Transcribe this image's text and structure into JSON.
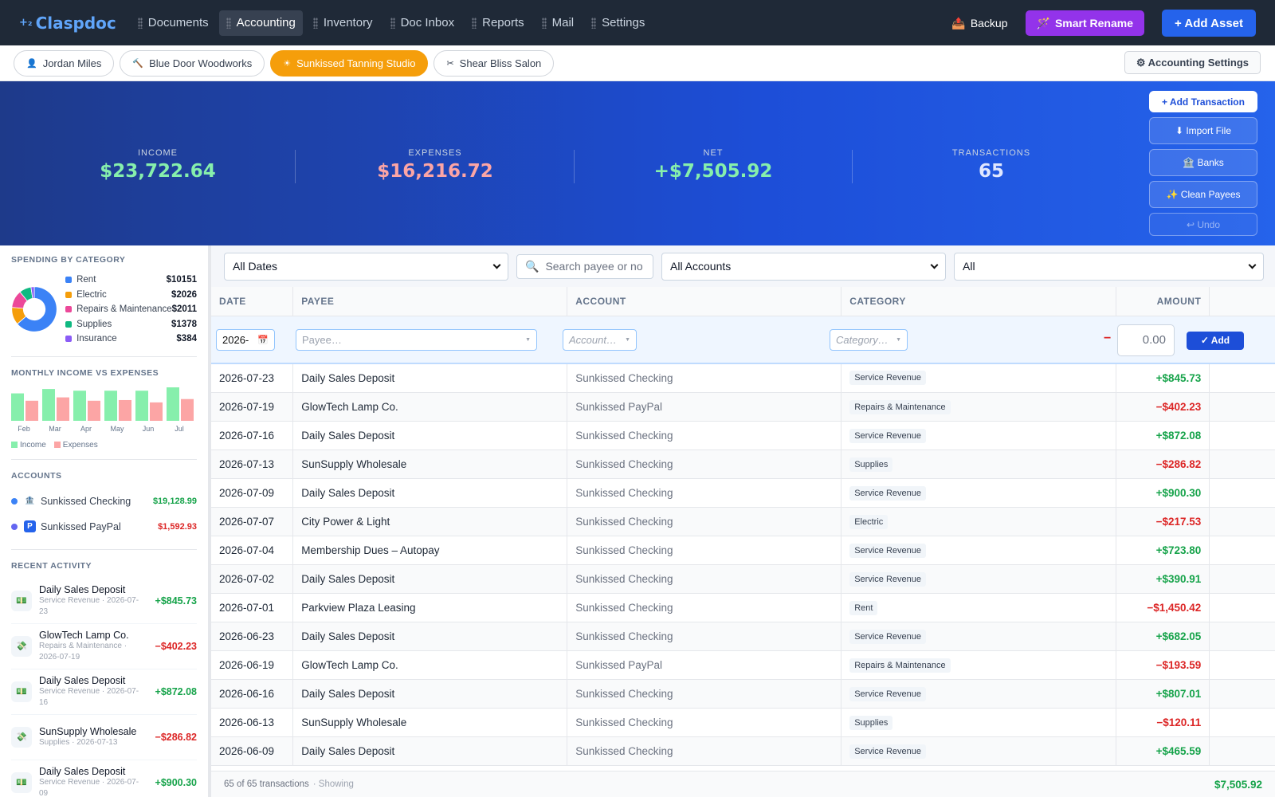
{
  "app": {
    "name": "Claspdoc",
    "logo_mark": "+₂"
  },
  "nav": {
    "items": [
      {
        "label": "Documents",
        "active": false
      },
      {
        "label": "Accounting",
        "active": true
      },
      {
        "label": "Inventory",
        "active": false
      },
      {
        "label": "Doc Inbox",
        "active": false
      },
      {
        "label": "Reports",
        "active": false
      },
      {
        "label": "Mail",
        "active": false
      },
      {
        "label": "Settings",
        "active": false
      }
    ],
    "backup_label": "Backup",
    "smart_rename_label": "Smart Rename",
    "add_asset_label": "+ Add Asset"
  },
  "entities": {
    "items": [
      {
        "label": "Jordan Miles",
        "icon": "user-icon",
        "active": false
      },
      {
        "label": "Blue Door Woodworks",
        "icon": "hammer-icon",
        "active": false
      },
      {
        "label": "Sunkissed Tanning Studio",
        "icon": "sun-icon",
        "active": true
      },
      {
        "label": "Shear Bliss Salon",
        "icon": "scissors-icon",
        "active": false
      }
    ],
    "settings_label": "⚙ Accounting Settings"
  },
  "stats": {
    "income": {
      "label": "INCOME",
      "value": "$23,722.64",
      "color": "#86efac"
    },
    "expenses": {
      "label": "EXPENSES",
      "value": "$16,216.72",
      "color": "#fca5a5"
    },
    "net": {
      "label": "NET",
      "value": "+$7,505.92",
      "color": "#86efac"
    },
    "transactions": {
      "label": "TRANSACTIONS",
      "value": "65",
      "color": "#e0e7ff"
    }
  },
  "banner_actions": {
    "add_transaction": "+ Add Transaction",
    "import_file": "⬇ Import File",
    "banks": "🏦 Banks",
    "clean_payees": "✨ Clean Payees",
    "undo": "↩ Undo"
  },
  "sidebar": {
    "spending_title": "SPENDING BY CATEGORY",
    "spending": [
      {
        "name": "Rent",
        "amount": "$10151",
        "value": 10151,
        "color": "#3b82f6"
      },
      {
        "name": "Electric",
        "amount": "$2026",
        "value": 2026,
        "color": "#f59e0b"
      },
      {
        "name": "Repairs & Maintenance",
        "amount": "$2011",
        "value": 2011,
        "color": "#ec4899"
      },
      {
        "name": "Supplies",
        "amount": "$1378",
        "value": 1378,
        "color": "#10b981"
      },
      {
        "name": "Insurance",
        "amount": "$384",
        "value": 384,
        "color": "#8b5cf6"
      }
    ],
    "monthly_title": "MONTHLY INCOME VS EXPENSES",
    "monthly": {
      "categories": [
        "Feb",
        "Mar",
        "Apr",
        "May",
        "Jun",
        "Jul"
      ],
      "income": [
        0.82,
        0.95,
        0.9,
        0.9,
        0.9,
        1.0
      ],
      "expenses": [
        0.6,
        0.7,
        0.6,
        0.62,
        0.55,
        0.65
      ],
      "income_label": "Income",
      "expenses_label": "Expenses",
      "income_color": "#86efac",
      "expenses_color": "#fca5a5"
    },
    "accounts_title": "ACCOUNTS",
    "accounts": [
      {
        "name": "Sunkissed Checking",
        "balance": "$19,128.99",
        "dot": "#3b82f6",
        "icon": "bank-icon",
        "icon_glyph": "🏦",
        "positive": true
      },
      {
        "name": "Sunkissed PayPal",
        "balance": "$1,592.93",
        "dot": "#6366f1",
        "icon": "paypal-icon",
        "icon_glyph": "P",
        "positive": false
      }
    ],
    "recent_title": "RECENT ACTIVITY",
    "recent": [
      {
        "title": "Daily Sales Deposit",
        "sub": "Service Revenue · 2026-07-23",
        "amount": "+$845.73",
        "positive": true,
        "glyph": "💵"
      },
      {
        "title": "GlowTech Lamp Co.",
        "sub": "Repairs & Maintenance · 2026-07-19",
        "amount": "−$402.23",
        "positive": false,
        "glyph": "💸"
      },
      {
        "title": "Daily Sales Deposit",
        "sub": "Service Revenue · 2026-07-16",
        "amount": "+$872.08",
        "positive": true,
        "glyph": "💵"
      },
      {
        "title": "SunSupply Wholesale",
        "sub": "Supplies · 2026-07-13",
        "amount": "−$286.82",
        "positive": false,
        "glyph": "💸"
      },
      {
        "title": "Daily Sales Deposit",
        "sub": "Service Revenue · 2026-07-09",
        "amount": "+$900.30",
        "positive": true,
        "glyph": "💵"
      }
    ]
  },
  "filters": {
    "dates": "All Dates",
    "search_placeholder": "Search payee or no",
    "accounts": "All Accounts",
    "type": "All"
  },
  "table": {
    "columns": [
      "DATE",
      "PAYEE",
      "ACCOUNT",
      "CATEGORY",
      "AMOUNT"
    ],
    "new_row": {
      "date": "2026-",
      "payee": "Payee…",
      "account": "Account…",
      "category": "Category…",
      "sign": "−",
      "amount": "0.00",
      "add": "✓ Add"
    },
    "rows": [
      {
        "date": "2026-07-23",
        "payee": "Daily Sales Deposit",
        "account": "Sunkissed Checking",
        "category": "Service Revenue",
        "amount": "+$845.73",
        "positive": true
      },
      {
        "date": "2026-07-19",
        "payee": "GlowTech Lamp Co.",
        "account": "Sunkissed PayPal",
        "category": "Repairs & Maintenance",
        "amount": "−$402.23",
        "positive": false
      },
      {
        "date": "2026-07-16",
        "payee": "Daily Sales Deposit",
        "account": "Sunkissed Checking",
        "category": "Service Revenue",
        "amount": "+$872.08",
        "positive": true
      },
      {
        "date": "2026-07-13",
        "payee": "SunSupply Wholesale",
        "account": "Sunkissed Checking",
        "category": "Supplies",
        "amount": "−$286.82",
        "positive": false
      },
      {
        "date": "2026-07-09",
        "payee": "Daily Sales Deposit",
        "account": "Sunkissed Checking",
        "category": "Service Revenue",
        "amount": "+$900.30",
        "positive": true
      },
      {
        "date": "2026-07-07",
        "payee": "City Power & Light",
        "account": "Sunkissed Checking",
        "category": "Electric",
        "amount": "−$217.53",
        "positive": false
      },
      {
        "date": "2026-07-04",
        "payee": "Membership Dues – Autopay",
        "account": "Sunkissed Checking",
        "category": "Service Revenue",
        "amount": "+$723.80",
        "positive": true
      },
      {
        "date": "2026-07-02",
        "payee": "Daily Sales Deposit",
        "account": "Sunkissed Checking",
        "category": "Service Revenue",
        "amount": "+$390.91",
        "positive": true
      },
      {
        "date": "2026-07-01",
        "payee": "Parkview Plaza Leasing",
        "account": "Sunkissed Checking",
        "category": "Rent",
        "amount": "−$1,450.42",
        "positive": false
      },
      {
        "date": "2026-06-23",
        "payee": "Daily Sales Deposit",
        "account": "Sunkissed Checking",
        "category": "Service Revenue",
        "amount": "+$682.05",
        "positive": true
      },
      {
        "date": "2026-06-19",
        "payee": "GlowTech Lamp Co.",
        "account": "Sunkissed PayPal",
        "category": "Repairs & Maintenance",
        "amount": "−$193.59",
        "positive": false
      },
      {
        "date": "2026-06-16",
        "payee": "Daily Sales Deposit",
        "account": "Sunkissed Checking",
        "category": "Service Revenue",
        "amount": "+$807.01",
        "positive": true
      },
      {
        "date": "2026-06-13",
        "payee": "SunSupply Wholesale",
        "account": "Sunkissed Checking",
        "category": "Supplies",
        "amount": "−$120.11",
        "positive": false
      },
      {
        "date": "2026-06-09",
        "payee": "Daily Sales Deposit",
        "account": "Sunkissed Checking",
        "category": "Service Revenue",
        "amount": "+$465.59",
        "positive": true
      }
    ]
  },
  "footer": {
    "count": "65 of 65 transactions",
    "showing": "· Showing",
    "total": "$7,505.92"
  }
}
